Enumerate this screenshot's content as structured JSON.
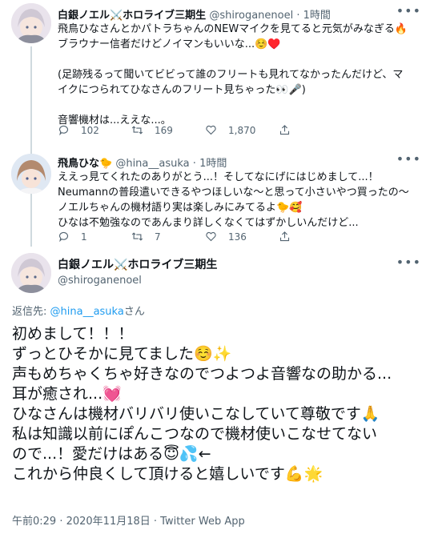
{
  "tweet1": {
    "author_name": "白銀ノエル⚔️ホロライブ三期生",
    "handle": "@shiroganenoel",
    "separator": "·",
    "time": "1時間",
    "text": "飛鳥ひなさんとかパトラちゃんのNEWマイクを見てると元気がみなぎる🔥\nブラウナー信者だけどノイマンもいいな...☺️♥️\n\n(足跡残るって聞いてビビって誰のフリートも見れてなかったんだけど、マ\nイクにつられてひなさんのフリート見ちゃった👀🎤)\n\n音響機材は...ええな...。",
    "replies": "102",
    "retweets": "169",
    "likes": "1,870"
  },
  "tweet2": {
    "author_name": "飛鳥ひな🐤",
    "handle": "@hina__asuka",
    "separator": "·",
    "time": "1時間",
    "text": "ええっ見てくれたのありがとう...！そしてなにげにはじめまして...！\nNeumannの普段遣いできるやつほしいな〜と思って小さいやつ買ったの〜\nノエルちゃんの機材語り実は楽しみにみてるよ🐤🥰\nひなは不勉強なのであんまり詳しくなくてはずかしいんだけど...",
    "replies": "1",
    "retweets": "7",
    "likes": "136"
  },
  "main": {
    "author_name": "白銀ノエル⚔️ホロライブ三期生",
    "handle": "@shiroganenoel",
    "reply_prefix": "返信先: ",
    "reply_handle": "@hina__asuka",
    "reply_suffix": "さん",
    "text": "初めまして！！！\nずっとひそかに見てました☺️✨\n声もめちゃくちゃ好きなのでつよつよ音響なの助かる...\n耳が癒され...💓\nひなさんは機材バリバリ使いこなしていて尊敬です🙏\n私は知識以前にぽんこつなので機材使いこなせてない\nので...！愛だけはある😇💦←\nこれから仲良くして頂けると嬉しいです💪🌟",
    "timestamp": "午前0:29 · 2020年11月18日 · Twitter Web App"
  },
  "icons": {
    "reply": "reply-icon",
    "retweet": "retweet-icon",
    "like": "heart-icon",
    "share": "share-icon",
    "more": "more-icon"
  },
  "colors": {
    "muted": "#536471",
    "link": "#1d9bf0",
    "thread_line": "#cfd9de",
    "text": "#0f1419"
  }
}
